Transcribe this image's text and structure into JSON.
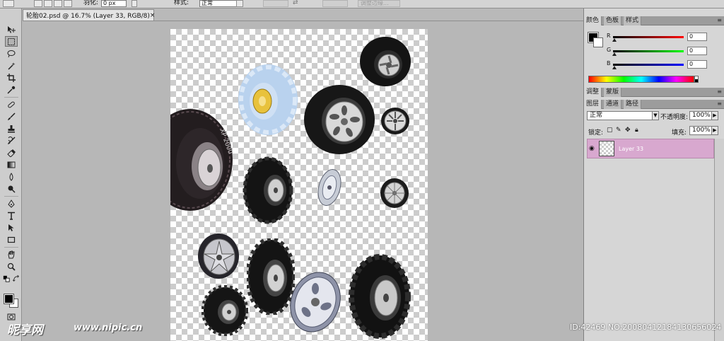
{
  "options_bar": {
    "feather_label": "羽化:",
    "feather_value": "0 px",
    "style_label": "样式:",
    "style_value": "正常",
    "refine_edge_label": "调整边缘..."
  },
  "tools": [
    "move",
    "marquee",
    "lasso",
    "magic-wand",
    "crop",
    "eyedropper",
    "healing",
    "brush",
    "clone-stamp",
    "history-brush",
    "eraser",
    "gradient",
    "blur",
    "dodge",
    "pen",
    "type",
    "path-select",
    "rectangle",
    "hand",
    "zoom"
  ],
  "document": {
    "tab_title": "轮胎02.psd @ 16.7% (Layer 33, RGB/8)",
    "close_symbol": "×"
  },
  "color_panel": {
    "tabs": [
      "颜色",
      "色板",
      "样式"
    ],
    "active_tab": "颜色",
    "sliders": [
      {
        "label": "R",
        "value": "0",
        "color": "#c00000"
      },
      {
        "label": "G",
        "value": "0",
        "color": "#00a000"
      },
      {
        "label": "B",
        "value": "0",
        "color": "#0000b0"
      }
    ]
  },
  "adjust_panel": {
    "tabs": [
      "调整",
      "蒙版"
    ]
  },
  "layers_panel": {
    "tabs": [
      "图层",
      "通道",
      "路径"
    ],
    "active_tab": "图层",
    "blend_mode": "正常",
    "opacity_label": "不透明度:",
    "opacity_value": "100%",
    "lock_label": "锁定:",
    "fill_label": "填充:",
    "fill_value": "100%",
    "layers": [
      {
        "name": "Layer 33",
        "selected": true,
        "visible": true,
        "highlight_color": "#d8a8cf"
      }
    ]
  },
  "watermark": {
    "logo": "昵享网",
    "url": "www.nipic.cn",
    "id": "ID:42469 NO:20080412184130656024"
  }
}
